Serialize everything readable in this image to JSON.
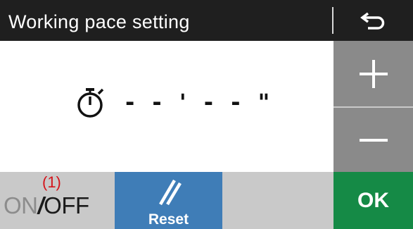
{
  "header": {
    "title": "Working pace setting",
    "back_icon": "back-arrow-icon"
  },
  "display": {
    "timer_icon": "stopwatch-icon",
    "pace_value": "- - ' - - \""
  },
  "controls": {
    "plus_icon": "plus-icon",
    "minus_icon": "minus-icon"
  },
  "bottom_bar": {
    "onoff": {
      "index": "(1)",
      "on": "ON",
      "slash": "/",
      "off": "OFF"
    },
    "reset": {
      "icon": "reset-slash-icon",
      "label": "Reset"
    },
    "ok_label": "OK"
  },
  "colors": {
    "title_bg": "#1f1f1f",
    "side_buttons": "#8a8a8a",
    "reset_blue": "#3f7db7",
    "ok_green": "#158a46",
    "index_red": "#d4141b"
  }
}
